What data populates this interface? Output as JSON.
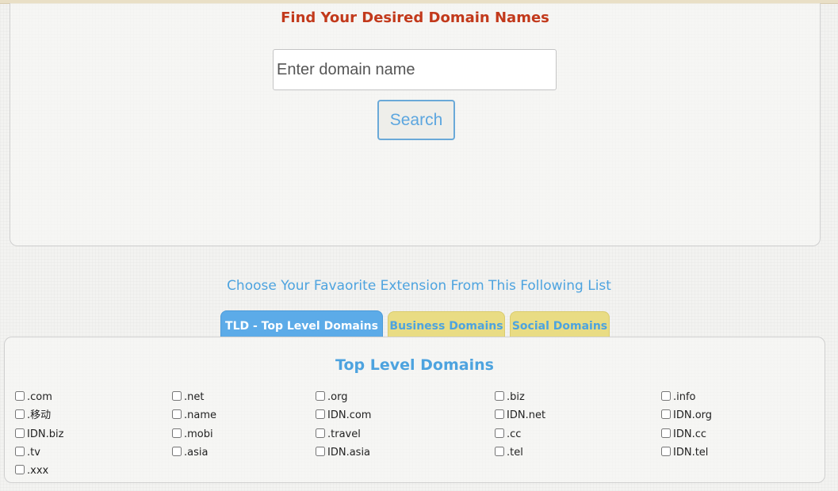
{
  "search_panel": {
    "title": "Find Your Desired Domain Names",
    "input_placeholder": "Enter domain name",
    "search_label": "Search"
  },
  "extensions_section": {
    "heading": "Choose Your Favaorite Extension From This Following List",
    "tabs": [
      {
        "label": "TLD - Top Level Domains",
        "active": true
      },
      {
        "label": "Business Domains",
        "active": false
      },
      {
        "label": "Social Domains",
        "active": false
      }
    ],
    "list_title": "Top Level Domains",
    "extensions": [
      {
        "label": ".com",
        "checked": false
      },
      {
        "label": ".net",
        "checked": false
      },
      {
        "label": ".org",
        "checked": false
      },
      {
        "label": ".biz",
        "checked": false
      },
      {
        "label": ".info",
        "checked": false
      },
      {
        "label": ".移动",
        "checked": false
      },
      {
        "label": ".name",
        "checked": false
      },
      {
        "label": "IDN.com",
        "checked": false
      },
      {
        "label": "IDN.net",
        "checked": false
      },
      {
        "label": "IDN.org",
        "checked": false
      },
      {
        "label": "IDN.biz",
        "checked": false
      },
      {
        "label": ".mobi",
        "checked": false
      },
      {
        "label": ".travel",
        "checked": false
      },
      {
        "label": ".cc",
        "checked": false
      },
      {
        "label": "IDN.cc",
        "checked": false
      },
      {
        "label": ".tv",
        "checked": false
      },
      {
        "label": ".asia",
        "checked": false
      },
      {
        "label": "IDN.asia",
        "checked": false
      },
      {
        "label": ".tel",
        "checked": false
      },
      {
        "label": "IDN.tel",
        "checked": false
      },
      {
        "label": ".xxx",
        "checked": false
      }
    ]
  },
  "colors": {
    "title_red": "#c2391b",
    "accent_blue": "#4da3df",
    "tab_active_bg": "#5cabe8",
    "tab_inactive_bg": "#e9dc84"
  }
}
